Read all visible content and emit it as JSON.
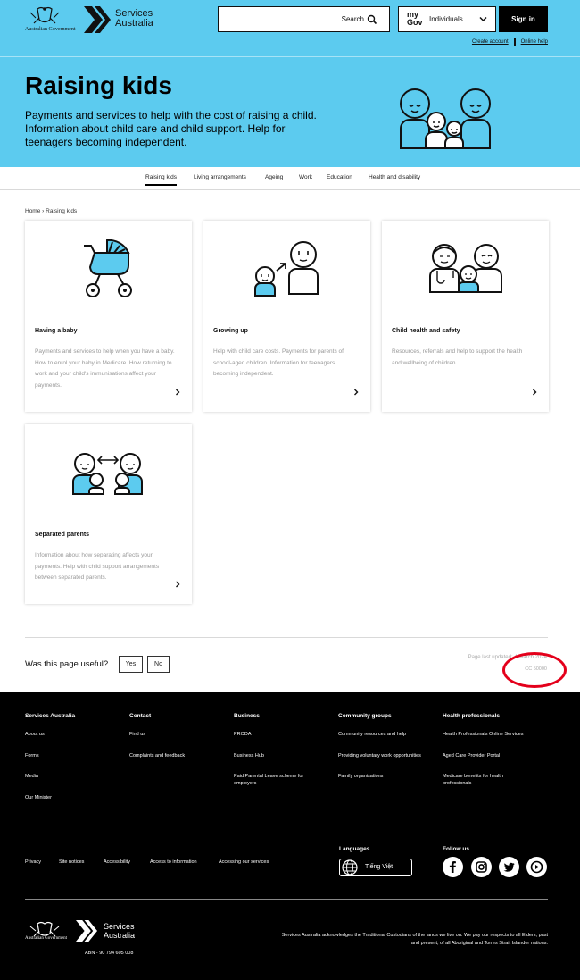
{
  "header": {
    "gov_name": "Australian Government",
    "brand_line1": "Services",
    "brand_line2": "Australia",
    "search_label": "Search",
    "mygov_logo_line1": "my",
    "mygov_logo_line2": "Gov",
    "mygov_selected": "Individuals",
    "signin_label": "Sign in",
    "create_account": "Create account",
    "online_help": "Online help"
  },
  "hero": {
    "title": "Raising kids",
    "description": "Payments and services to help with the cost of raising a child. Information about child care and child support. Help for teenagers becoming independent."
  },
  "tabs": [
    {
      "label": "Raising kids",
      "active": true
    },
    {
      "label": "Living arrangements"
    },
    {
      "label": "Ageing"
    },
    {
      "label": "Work"
    },
    {
      "label": "Education"
    },
    {
      "label": "Health and disability"
    }
  ],
  "breadcrumb": {
    "home": "Home",
    "current": "Raising kids"
  },
  "cards": [
    {
      "title": "Having a baby",
      "description": "Payments and services to help when you have a baby. How to enrol your baby in Medicare. How returning to work and your child's immunisations affect your payments.",
      "icon": "pram-icon"
    },
    {
      "title": "Growing up",
      "description": "Help with child care costs. Payments for parents of school-aged children. Information for teenagers becoming independent.",
      "icon": "growing-child-icon"
    },
    {
      "title": "Child health and safety",
      "description": "Resources, referrals and help to support the health and wellbeing of children.",
      "icon": "doctor-family-icon"
    },
    {
      "title": "Separated parents",
      "description": "Information about how separating affects your payments. Help with child support arrangements between separated parents.",
      "icon": "separated-parents-icon"
    }
  ],
  "feedback": {
    "question": "Was this page useful?",
    "yes": "Yes",
    "no": "No",
    "last_updated": "Page last updated: 4 March 2024",
    "page_id": "CC 50000"
  },
  "footer": {
    "columns": [
      {
        "heading": "Services Australia",
        "links": [
          "About us",
          "Forms",
          "Media",
          "Our Minister"
        ]
      },
      {
        "heading": "Contact",
        "links": [
          "Find us",
          "Complaints and feedback"
        ]
      },
      {
        "heading": "Business",
        "links": [
          "PRODA",
          "Business Hub",
          "Paid Parental Leave scheme for employers"
        ]
      },
      {
        "heading": "Community groups",
        "links": [
          "Community resources and help",
          "Providing voluntary work opportunities",
          "Family organisations"
        ]
      },
      {
        "heading": "Health professionals",
        "links": [
          "Health Professionals Online Services",
          "Aged Care Provider Portal",
          "Medicare benefits for health professionals"
        ]
      }
    ],
    "legal_links": [
      "Privacy",
      "Site notices",
      "Accessibility",
      "Access to information",
      "Accessing our services"
    ],
    "languages_label": "Languages",
    "language_button": "Tiếng Việt",
    "follow_label": "Follow us",
    "social": [
      "facebook-icon",
      "instagram-icon",
      "twitter-icon",
      "youtube-icon"
    ],
    "acknowledgement": "Services Australia acknowledges the Traditional Custodians of the lands we live on. We pay our respects to all Elders, past and present, of all Aboriginal and Torres Strait Islander nations.",
    "abn": "ABN - 90 794 605 008"
  },
  "colors": {
    "header_bg": "#5ccbef",
    "footer_bg": "#000000",
    "accent": "#5ccbef",
    "highlight_circle": "#e4001b"
  }
}
